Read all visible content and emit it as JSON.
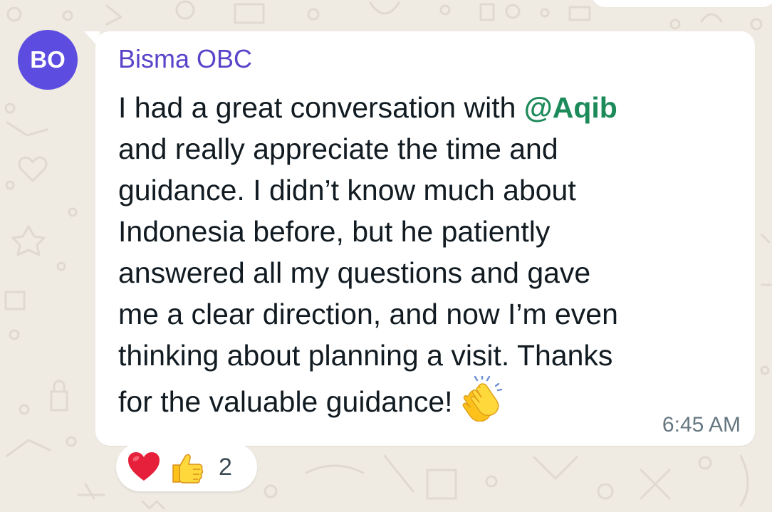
{
  "chat": {
    "avatar_initials": "BO",
    "avatar_color": "#5c4de0",
    "sender_name": "Bisma OBC",
    "sender_name_color": "#5b43c9",
    "message": {
      "line1_before_mention": "I had a great conversation with ",
      "mention": "@Aqib",
      "mention_color": "#1d8a5a",
      "line2": "and really appreciate the time and",
      "line3": "guidance. I didn’t know much about",
      "line4": "Indonesia before, but he patiently",
      "line5": "answered all my questions and gave",
      "line6": "me a clear direction, and now I’m even",
      "line7": "thinking about planning a visit. Thanks",
      "line8": "for the valuable guidance!",
      "trailing_emoji": "clapping-hands-icon"
    },
    "timestamp": "6:45 AM",
    "reactions": {
      "emojis": [
        "red-heart-icon",
        "thumbs-up-icon"
      ],
      "count": "2"
    }
  },
  "colors": {
    "wallpaper": "#efeae2",
    "bubble": "#ffffff",
    "timestamp": "#667781"
  }
}
